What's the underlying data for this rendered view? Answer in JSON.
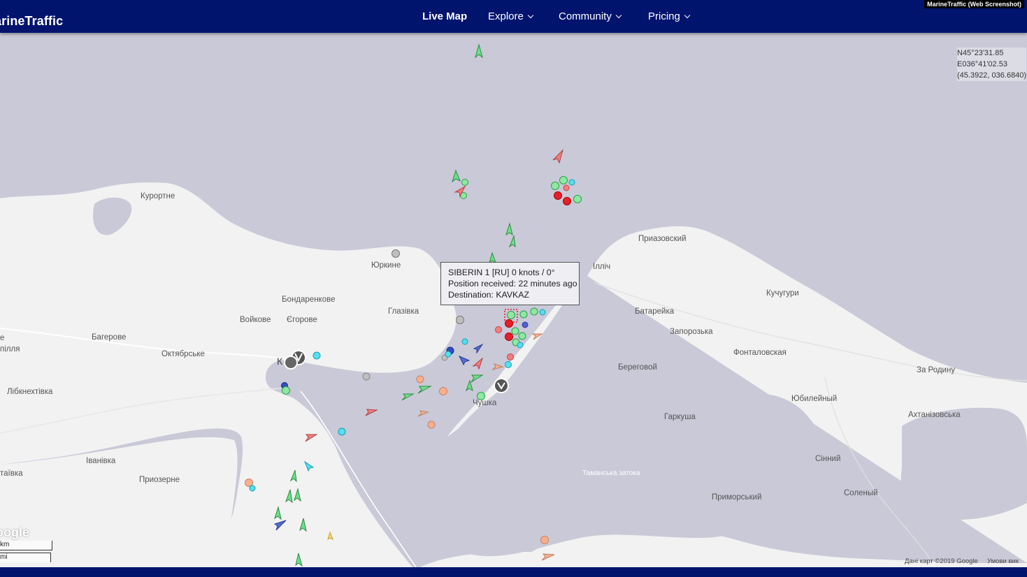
{
  "header": {
    "logo_text": "arineTraffic",
    "nav": [
      {
        "label": "Live Map"
      },
      {
        "label": "Explore"
      },
      {
        "label": "Community"
      },
      {
        "label": "Pricing"
      }
    ],
    "watermark": "MarineTraffic (Web Screenshot)"
  },
  "coords": {
    "lat": "N45°23'31.85",
    "lon": "E036°41'02.53",
    "decimal": "(45.3922, 036.6840)"
  },
  "tooltip": {
    "line1": "SIBERIN 1 [RU] 0 knots / 0°",
    "line2": "Position received: 22 minutes ago",
    "line3": "Destination: KAVKAZ"
  },
  "places": {
    "kurortne": "Курортне",
    "yurkyne": "Юркине",
    "bondarenkove": "Бондаренкове",
    "hlazivka": "Глазівка",
    "voikove": "Войкове",
    "yehorove": "Єгорове",
    "baherove": "Багерове",
    "oktiabrske": "Октябрське",
    "e_edge": "е",
    "pillia": "пілля",
    "libknekhtivka": "Лібкнехтівка",
    "ivanivka": "Іванівка",
    "taivka": "таївка",
    "pryozerne": "Приозерне",
    "chushka": "Чушка",
    "pryazovskyi": "Приазовский",
    "illich": "Ілліч",
    "kuchuhury": "Кучугури",
    "batareika": "Батарейка",
    "zaporozka": "Запорозька",
    "fontalovskaia": "Фонталовская",
    "za_rodynu": "За Родину",
    "berehovoi": "Береговой",
    "yubileinyi": "Юбилейный",
    "harkusha": "Гаркуша",
    "akhtanizovska": "Ахтанізовська",
    "sinnyi": "Сінний",
    "solenyi": "Соленый",
    "prymorskyi": "Приморський",
    "tamanska": "Таманська затока",
    "k_letter": "К"
  },
  "map_ui": {
    "google": "oogle",
    "scale_km": "km",
    "scale_mi": "mi",
    "attribution_data": "Дані карт ©2019 Google",
    "attribution_terms": "Умови вик"
  }
}
